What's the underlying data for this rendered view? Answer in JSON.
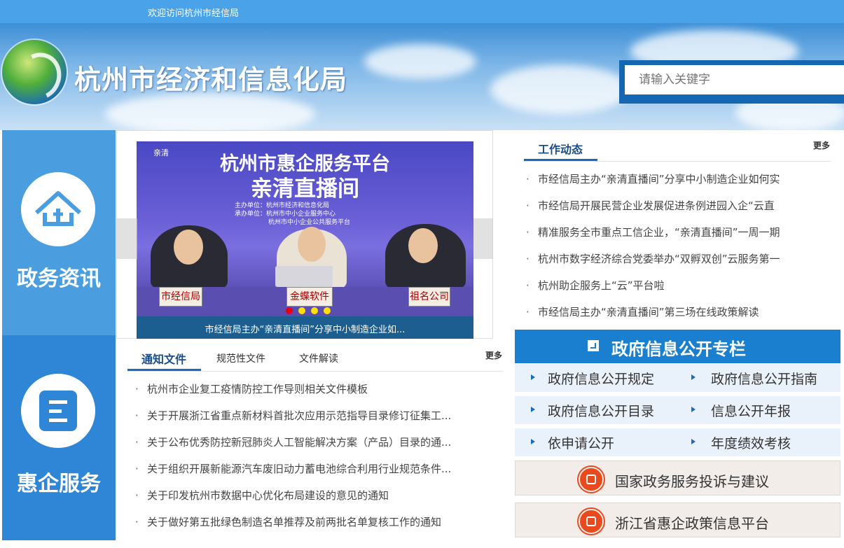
{
  "topbar": {
    "welcome": "欢迎访问杭州市经信局"
  },
  "header": {
    "title": "杭州市经济和信息化局",
    "search_placeholder": "请输入关键字"
  },
  "sidebar": [
    {
      "label": "政务资讯",
      "icon": "house-icon",
      "color": "#4a9ee0"
    },
    {
      "label": "惠企服务",
      "icon": "document-icon",
      "color": "#2f86d6"
    }
  ],
  "carousel": {
    "banner_title_1": "杭州市惠企服务平台",
    "banner_title_2": "亲清直播间",
    "banner_info_1": "主办单位：杭州市经济和信息化局",
    "banner_info_2": "承办单位：杭州市中小企业服务中心",
    "banner_info_3": "杭州市中小企业公共服务平台",
    "ribbon": "亲清",
    "nameplates": [
      "市经信局",
      "金蝶软件",
      "祖名公司"
    ],
    "caption": "市经信局主办“亲清直播间”分享中小制造企业如..."
  },
  "notice": {
    "tabs": [
      "通知文件",
      "规范性文件",
      "文件解读"
    ],
    "more": "更多",
    "items": [
      "杭州市企业复工疫情防控工作导则相关文件模板",
      "关于开展浙江省重点新材料首批次应用示范指导目录修订征集工...",
      "关于公布优秀防控新冠肺炎人工智能解决方案（产品）目录的通...",
      "关于组织开展新能源汽车废旧动力蓄电池综合利用行业规范条件...",
      "关于印发杭州市数据中心优化布局建设的意见的通知",
      "关于做好第五批绿色制造名单推荐及前两批名单复核工作的通知"
    ]
  },
  "news": {
    "tab": "工作动态",
    "more": "更多",
    "items": [
      "市经信局主办“亲清直播间”分享中小制造企业如何实",
      "市经信局开展民营企业发展促进条例进园入企“云直",
      "精准服务全市重点工信企业，“亲清直播间”一周一期",
      "杭州市数字经济综合党委举办“双孵双创”云服务第一",
      "杭州助企服务上“云”平台啦",
      "市经信局主办“亲清直播间”第三场在线政策解读"
    ]
  },
  "gov": {
    "title": "政府信息公开专栏",
    "rows": [
      [
        "政府信息公开规定",
        "政府信息公开指南"
      ],
      [
        "政府信息公开目录",
        "信息公开年报"
      ],
      [
        "依申请公开",
        "年度绩效考核"
      ]
    ]
  },
  "portals": [
    {
      "label": "国家政务服务投诉与建议",
      "icon": "complaint-icon"
    },
    {
      "label": "浙江省惠企政策信息平台",
      "icon": "policy-icon"
    }
  ],
  "colors": {
    "topbar": "#4aa3e8",
    "primary": "#1a7fcf",
    "dark_blue": "#1467b0",
    "dot_active": "#e60012",
    "dot": "#ffe000"
  }
}
